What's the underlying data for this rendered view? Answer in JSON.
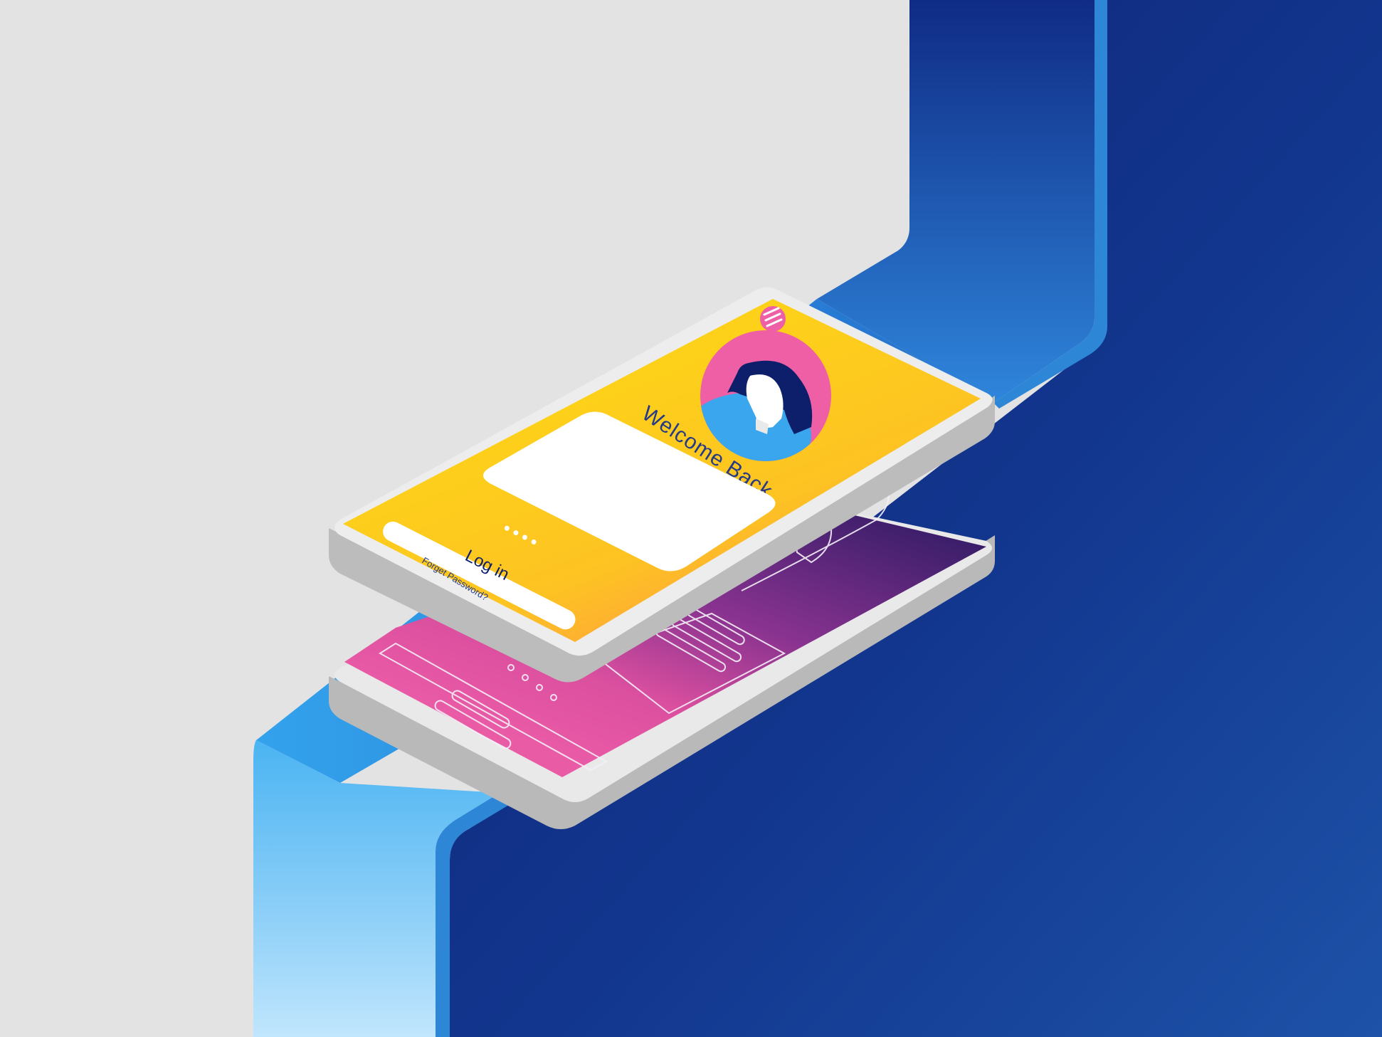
{
  "illustration": {
    "colors": {
      "background": "#e3e3e3",
      "wall_dark": "#0f2d86",
      "wall_light": "#39a6ee",
      "wall_edge": "#2d86d6",
      "device_body": "#bdbdbd",
      "device_top": "#ededed",
      "card_yellow": "#fdd01a",
      "card_orange": "#ffa63b",
      "back_screen_pink": "#e255a1",
      "back_screen_purple": "#5a2a86",
      "avatar_ring": "#ef5fa5",
      "avatar_hair": "#0d1f6a",
      "avatar_shirt": "#39a6ee"
    },
    "front_device": {
      "menu_icon": "hamburger-menu-icon",
      "avatar_icon": "user-avatar-icon",
      "welcome_text": "Welcome Back",
      "password_dots": "● ● ● ●",
      "login_label": "Log in",
      "forgot_link": "Forget Password?"
    },
    "back_device": {
      "wireframe_icon": "wireframe-avatar-icon"
    }
  }
}
